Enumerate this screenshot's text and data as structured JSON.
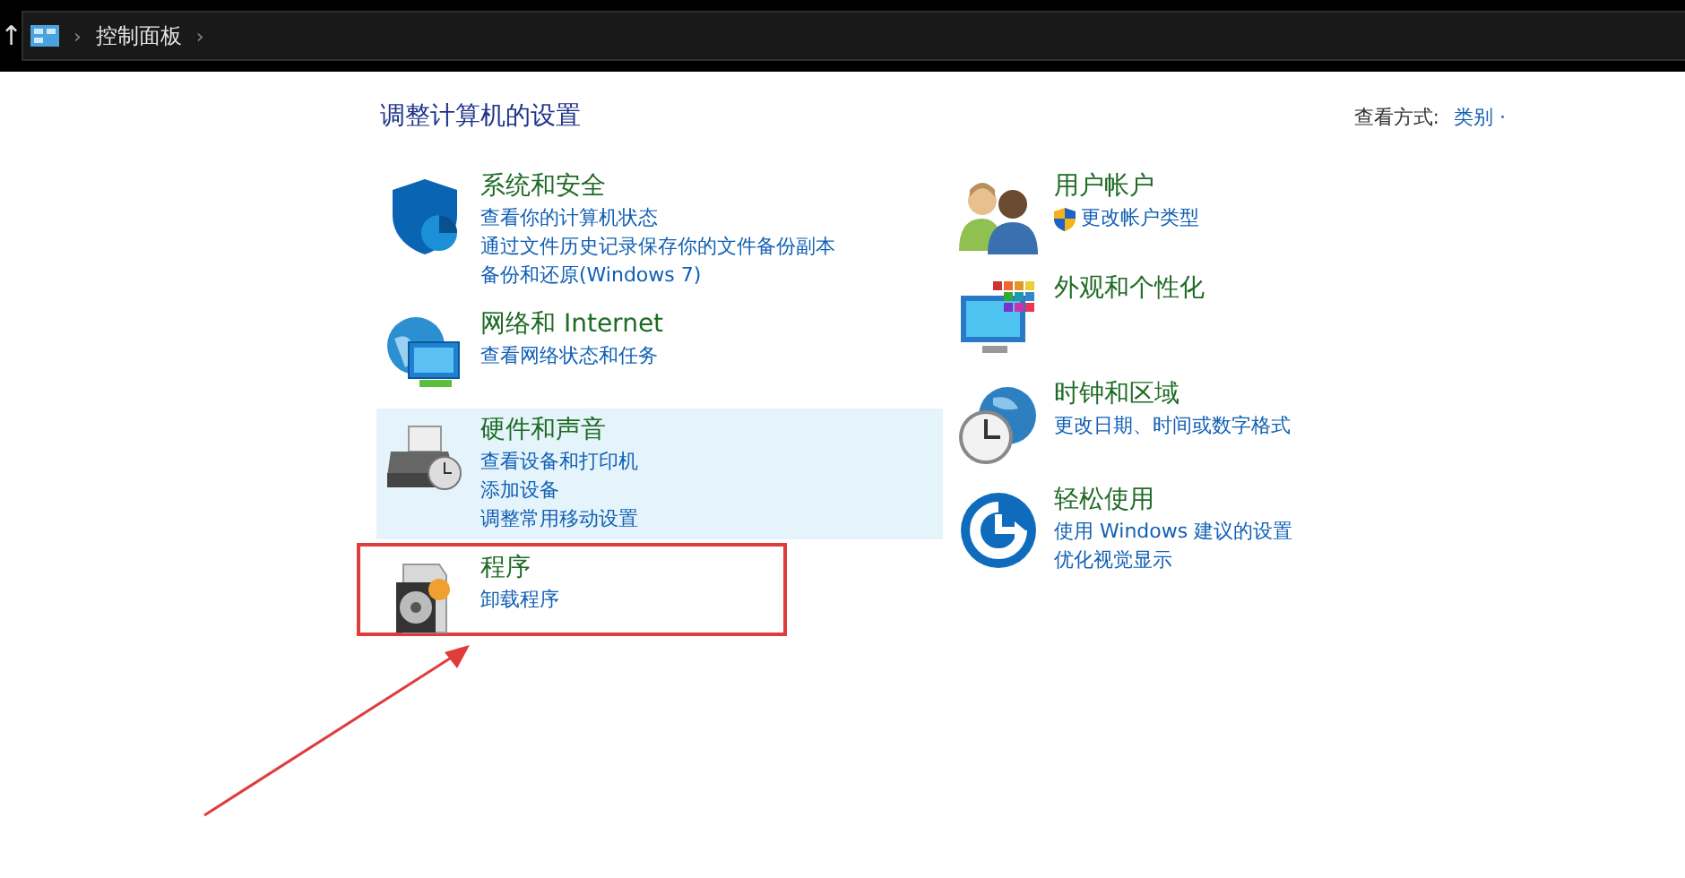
{
  "address_bar": {
    "up_arrow": "↑",
    "breadcrumbs": [
      {
        "label": "控制面板",
        "separator": "›"
      }
    ],
    "trailing_separator": "›"
  },
  "heading": "调整计算机的设置",
  "view_by": {
    "label": "查看方式:",
    "value": "类别",
    "caret": "·"
  },
  "columns": [
    [
      {
        "kind": "security",
        "title": "系统和安全",
        "highlighted": false,
        "links": [
          {
            "text": "查看你的计算机状态",
            "shield": false
          },
          {
            "text": "通过文件历史记录保存你的文件备份副本",
            "shield": false
          },
          {
            "text": "备份和还原(Windows 7)",
            "shield": false
          }
        ]
      },
      {
        "kind": "network",
        "title": "网络和 Internet",
        "highlighted": false,
        "links": [
          {
            "text": "查看网络状态和任务",
            "shield": false
          }
        ]
      },
      {
        "kind": "hardware",
        "title": "硬件和声音",
        "highlighted": true,
        "links": [
          {
            "text": "查看设备和打印机",
            "shield": false
          },
          {
            "text": "添加设备",
            "shield": false
          },
          {
            "text": "调整常用移动设置",
            "shield": false
          }
        ]
      },
      {
        "kind": "programs",
        "title": "程序",
        "highlighted": false,
        "links": [
          {
            "text": "卸载程序",
            "shield": false
          }
        ]
      }
    ],
    [
      {
        "kind": "users",
        "title": "用户帐户",
        "highlighted": false,
        "links": [
          {
            "text": "更改帐户类型",
            "shield": true
          }
        ]
      },
      {
        "kind": "appearance",
        "title": "外观和个性化",
        "highlighted": false
      },
      {
        "kind": "clock",
        "title": "时钟和区域",
        "highlighted": false,
        "links": [
          {
            "text": "更改日期、时间或数字格式",
            "shield": false
          }
        ]
      },
      {
        "kind": "ease",
        "title": "轻松使用",
        "highlighted": false,
        "links": [
          {
            "text": "使用 Windows 建议的设置",
            "shield": false
          },
          {
            "text": "优化视觉显示",
            "shield": false
          }
        ]
      }
    ]
  ]
}
